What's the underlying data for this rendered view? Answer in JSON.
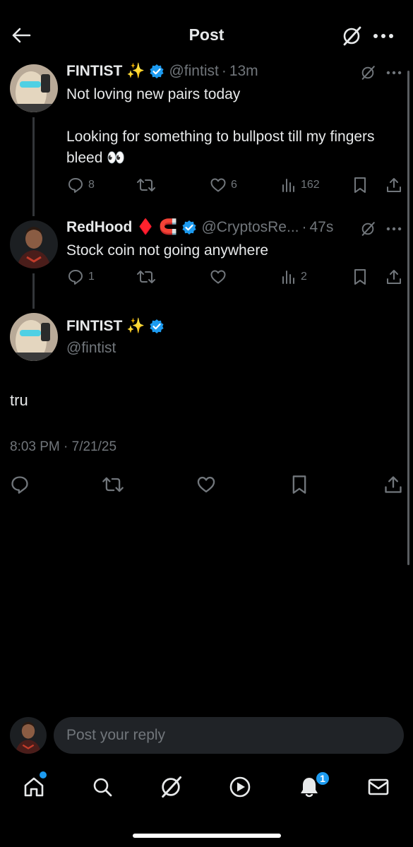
{
  "header": {
    "title": "Post"
  },
  "posts": [
    {
      "name": "FINTIST",
      "emoji": "✨",
      "handle": "@fintist",
      "sep": "·",
      "time": "13m",
      "text": "Not loving new pairs today\n\nLooking for something to bullpost till my fingers bleed 👀",
      "replies": "8",
      "reposts": "",
      "likes": "6",
      "views": "162"
    },
    {
      "name": "RedHood",
      "emoji": "♦️ 🧲",
      "handle": "@CryptosRe...",
      "sep": "·",
      "time": "47s",
      "text": "Stock coin not going anywhere",
      "replies": "1",
      "reposts": "",
      "likes": "",
      "views": "2"
    }
  ],
  "main_post": {
    "name": "FINTIST",
    "emoji": "✨",
    "handle": "@fintist",
    "text": "tru",
    "timestamp": "8:03 PM · 7/21/25"
  },
  "reply": {
    "placeholder": "Post your reply"
  },
  "nav": {
    "notifications_count": "1"
  },
  "colors": {
    "accent": "#1d9bf0",
    "muted": "#71767b",
    "background": "#000000"
  }
}
